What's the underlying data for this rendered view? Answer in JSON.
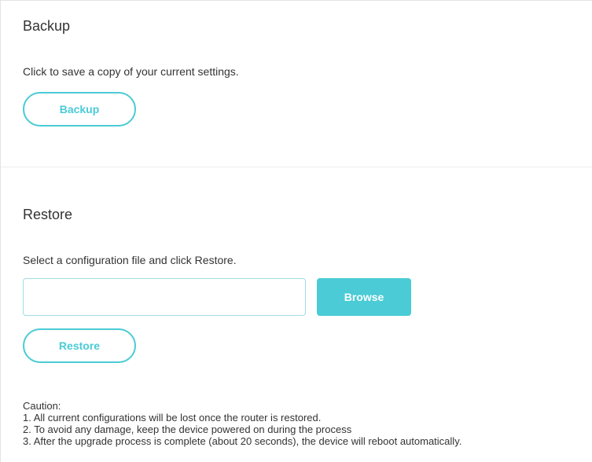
{
  "backup": {
    "title": "Backup",
    "description": "Click to save a copy of your current settings.",
    "button_label": "Backup"
  },
  "restore": {
    "title": "Restore",
    "description": "Select a configuration file and click Restore.",
    "file_input_value": "",
    "browse_label": "Browse",
    "button_label": "Restore"
  },
  "caution": {
    "heading": "Caution:",
    "items": [
      "1. All current configurations will be lost once the router is restored.",
      "2. To avoid any damage, keep the device powered on during the process",
      "3. After the upgrade process is complete (about 20 seconds), the device will reboot automatically."
    ]
  },
  "colors": {
    "accent": "#4acbd6",
    "text": "#333333",
    "input_border": "#9fdde3"
  }
}
